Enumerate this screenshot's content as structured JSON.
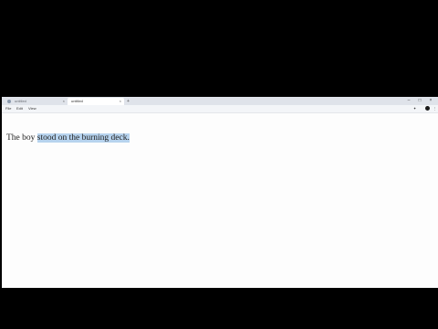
{
  "browser": {
    "tabs": [
      {
        "label": "untitled"
      },
      {
        "label": "untitled"
      }
    ],
    "new_tab": "+",
    "tab_close": "×",
    "window_controls": {
      "minimize": "–",
      "maximize": "□",
      "close": "×"
    }
  },
  "menu": {
    "items": [
      "File",
      "Edit",
      "View"
    ]
  },
  "toolbar": {
    "extensions_icon": "puzzle-icon",
    "profile_icon": "avatar",
    "menu_icon": "kebab-icon",
    "menu_glyph": "⋮",
    "ext_glyph": "✦"
  },
  "document": {
    "text_plain": "The boy ",
    "text_selected": "stood on the burning deck."
  },
  "colors": {
    "selection": "#b7d3ee",
    "page": "#fdfdfd",
    "backdrop": "#000000"
  }
}
